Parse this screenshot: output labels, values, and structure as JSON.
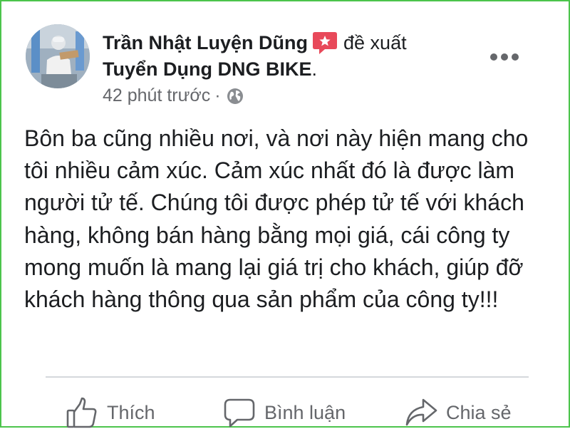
{
  "post": {
    "author": "Trần Nhật Luyện Dũng",
    "action_text": "đề xuất",
    "page_name": "Tuyển Dụng DNG BIKE",
    "page_name_suffix": ".",
    "timestamp": "42 phút trước",
    "meta_separator": "·",
    "privacy_icon": "globe-icon",
    "badge_icon": "recommend-star-icon",
    "more_icon": "more-options-icon",
    "body": "Bôn ba cũng nhiều nơi, và nơi này hiện mang cho tôi nhiều cảm xúc. Cảm xúc nhất đó là được làm người tử tế. Chúng tôi được phép tử tế với khách hàng, không bán hàng bằng mọi giá, cái công ty mong muốn là mang lại giá trị cho khách, giúp đỡ khách hàng thông qua sản phẩm của công ty!!!"
  },
  "actions": {
    "like": {
      "label": "Thích",
      "icon": "thumbs-up-icon"
    },
    "comment": {
      "label": "Bình luận",
      "icon": "comment-bubble-icon"
    },
    "share": {
      "label": "Chia sẻ",
      "icon": "share-arrow-icon"
    }
  },
  "colors": {
    "frame_border": "#4cc44c",
    "badge": "#e8495a",
    "text_primary": "#1c1e21",
    "text_secondary": "#65676b",
    "divider": "#d5d8dc"
  }
}
